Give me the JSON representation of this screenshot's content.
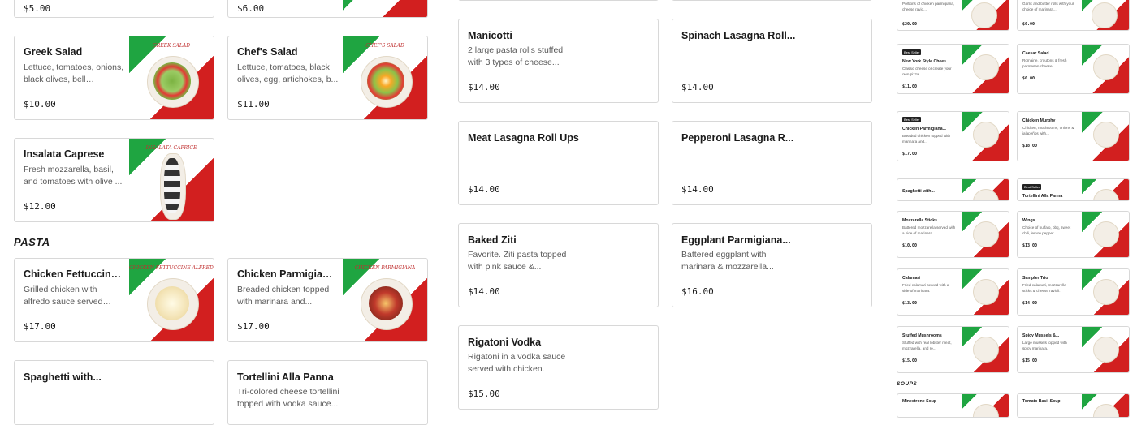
{
  "colors": {
    "green": "#1fa541",
    "red": "#d21f1f",
    "border": "#d8d8d8"
  },
  "sections": {
    "pasta": "PASTA",
    "soups": "SOUPS"
  },
  "left": {
    "top_prices": [
      "$5.00",
      "$6.00"
    ],
    "cards": [
      {
        "title": "Greek Salad",
        "desc": "Lettuce, tomatoes, onions, black olives, bell peppers...",
        "price": "$10.00",
        "img": "GREEK SALAD"
      },
      {
        "title": "Chef's Salad",
        "desc": "Lettuce, tomatoes, black olives, egg, artichokes, b...",
        "price": "$11.00",
        "img": "CHEF'S SALAD"
      },
      {
        "title": "Insalata Caprese",
        "desc": "Fresh mozzarella, basil, and tomatoes with olive ...",
        "price": "$12.00",
        "img": "INSALATA CAPRICE"
      },
      {
        "title": "Chicken Fettuccine...",
        "desc": "Grilled chicken with alfredo sauce served with...",
        "price": "$17.00",
        "img": "CHICKEN FETTUCCINE ALFREDO"
      },
      {
        "title": "Chicken Parmigiana...",
        "desc": "Breaded chicken topped with marinara and...",
        "price": "$17.00",
        "img": "CHICKEN PARMIGIANA"
      },
      {
        "title": "Spaghetti with...",
        "desc": "",
        "price": ""
      },
      {
        "title": "Tortellini Alla Panna",
        "desc": "Tri-colored cheese tortellini topped with vodka sauce...",
        "price": ""
      }
    ]
  },
  "middle": {
    "cards": [
      {
        "title": "Manicotti",
        "desc": "2 large pasta rolls stuffed with 3 types of cheese...",
        "price": "$14.00"
      },
      {
        "title": "Spinach Lasagna Roll...",
        "desc": "",
        "price": "$14.00"
      },
      {
        "title": "Meat Lasagna Roll Ups",
        "desc": "",
        "price": "$14.00"
      },
      {
        "title": "Pepperoni Lasagna R...",
        "desc": "",
        "price": "$14.00"
      },
      {
        "title": "Baked Ziti",
        "desc": "Favorite. Ziti pasta topped with pink sauce &...",
        "price": "$14.00"
      },
      {
        "title": "Eggplant Parmigiana...",
        "desc": "Battered eggplant with marinara & mozzarella...",
        "price": "$16.00"
      },
      {
        "title": "Rigatoni Vodka",
        "desc": "Rigatoni in a vodka sauce served with chicken.",
        "price": "$15.00"
      }
    ]
  },
  "right": {
    "top": [
      {
        "desc": "Portions of chicken parmigiana, cheese ravio...",
        "price": "$20.00"
      },
      {
        "desc": "Garlic and butter rolls with your choice of marinara...",
        "price": "$6.00"
      }
    ],
    "cards": [
      {
        "badge": "Best Seller",
        "title": "New York Style Chees...",
        "desc": "Classic cheese or create your own pizza.",
        "price": "$11.00"
      },
      {
        "badge": "",
        "title": "Caesar Salad",
        "desc": "Romaine, croutons & fresh parmesan cheese.",
        "price": "$6.00"
      },
      {
        "badge": "Best Seller",
        "title": "Chicken Parmigiana...",
        "desc": "Breaded chicken topped with marinara and...",
        "price": "$17.00"
      },
      {
        "badge": "",
        "title": "Chicken Murphy",
        "desc": "Chicken, mushrooms, onions & jalapeños with...",
        "price": "$18.00"
      },
      {
        "badge": "",
        "title": "Spaghetti with...",
        "desc": "",
        "price": ""
      },
      {
        "badge": "Best Seller",
        "title": "Tortellini Alla Panna",
        "desc": "",
        "price": ""
      },
      {
        "badge": "",
        "title": "Mozzarella Sticks",
        "desc": "Battered mozzarella served with a side of marinara.",
        "price": "$10.00"
      },
      {
        "badge": "",
        "title": "Wings",
        "desc": "Choice of buffalo, bbq, sweet chili, lemon pepper...",
        "price": "$13.00"
      },
      {
        "badge": "",
        "title": "Calamari",
        "desc": "Fried calamari served with a side of marinara.",
        "price": "$13.00"
      },
      {
        "badge": "",
        "title": "Sampler Trio",
        "desc": "Fried calamari, mozzarella sticks & cheese ravioli.",
        "price": "$14.00"
      },
      {
        "badge": "",
        "title": "Stuffed Mushrooms",
        "desc": "Stuffed with real lobster meat, mozzarella, and re...",
        "price": "$15.00"
      },
      {
        "badge": "",
        "title": "Spicy Mussels &...",
        "desc": "Large mussels topped with spicy marinara.",
        "price": "$15.00"
      },
      {
        "badge": "",
        "title": "Minestrone Soup",
        "desc": "",
        "price": ""
      },
      {
        "badge": "",
        "title": "Tomato Basil Soup",
        "desc": "",
        "price": ""
      }
    ]
  }
}
